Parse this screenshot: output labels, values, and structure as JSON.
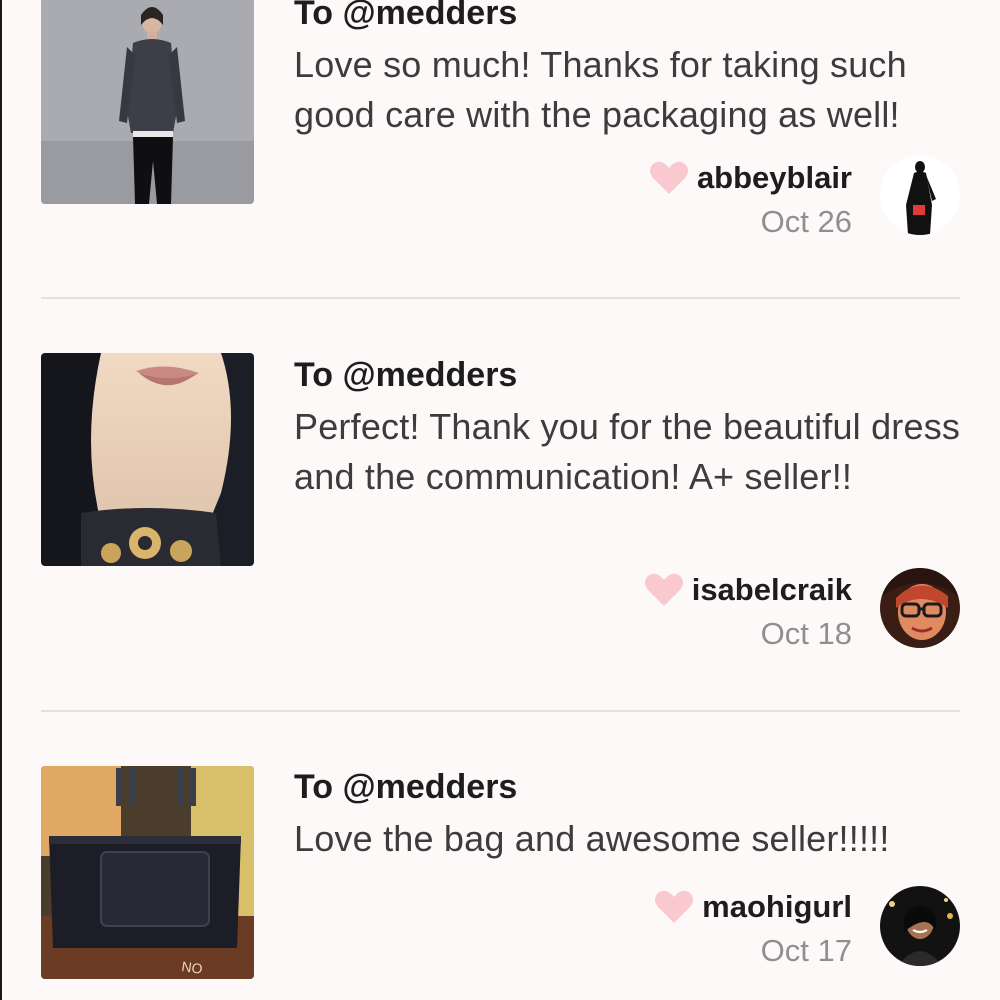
{
  "reviews": [
    {
      "to": "To @medders",
      "message": "Love so much! Thanks for taking such good care with the packaging as well!",
      "username": "abbeyblair",
      "date": "Oct 26",
      "thumb_icon": "photo-model-grey-top",
      "avatar_icon": "avatar-silhouette"
    },
    {
      "to": "To @medders",
      "message": "Perfect! Thank you for the beautiful dress and the communication! A+ seller!!",
      "username": "isabelcraik",
      "date": "Oct 18",
      "thumb_icon": "photo-selfie-dress",
      "avatar_icon": "avatar-glasses-girl"
    },
    {
      "to": "To @medders",
      "message": "Love the bag and awesome seller!!!!!",
      "username": "maohigurl",
      "date": "Oct 17",
      "thumb_icon": "photo-black-handbag",
      "avatar_icon": "avatar-night-portrait"
    }
  ],
  "colors": {
    "background": "#fcf9f8",
    "heart": "#f9c9cf",
    "username": "#1d1d1d",
    "date": "#8f8f8f",
    "divider": "#e3e0df"
  }
}
